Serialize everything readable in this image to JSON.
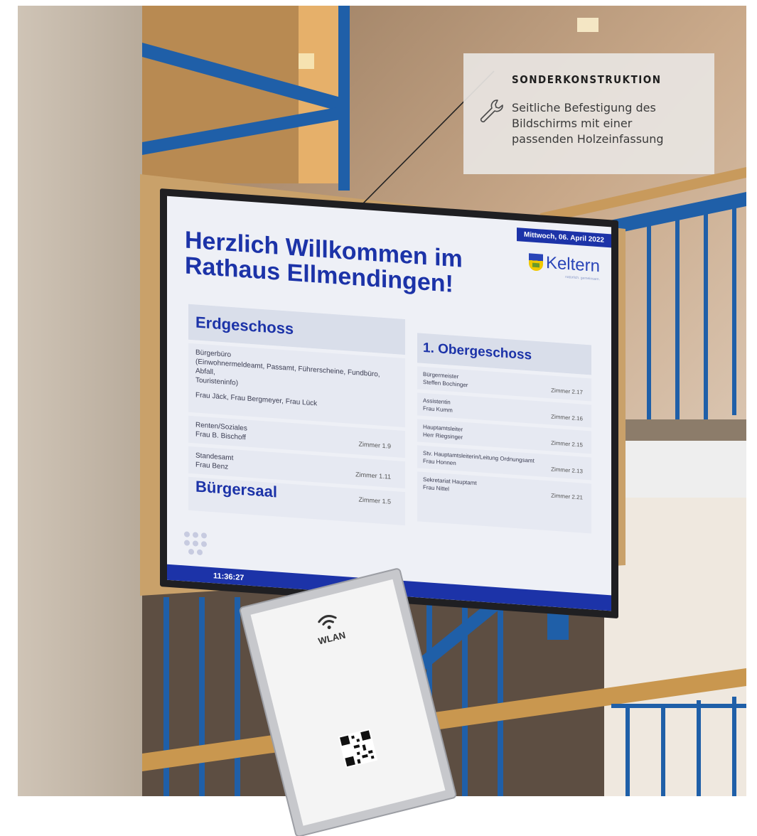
{
  "callout": {
    "title": "SONDERKONSTRUKTION",
    "lines": [
      "Seitliche Befestigung des",
      "Bildschirms mit einer",
      "passenden Holzeinfassung"
    ],
    "icon": "wrench-icon"
  },
  "display": {
    "headline": [
      "Herzlich Willkommen im",
      "Rathaus Ellmendingen!"
    ],
    "date": "Mittwoch, 06. April 2022",
    "logo": {
      "name": "Keltern",
      "tagline": "natürlich. gemeinsam."
    },
    "clock": "11:36:27",
    "erdgeschoss": {
      "title": "Erdgeschoss",
      "buergerbuero": {
        "lines": [
          "Bürgerbüro",
          "(Einwohnermeldeamt, Passamt, Führerscheine, Fundbüro, Abfall,",
          "Touristeninfo)"
        ],
        "staff": "Frau Jäck, Frau Bergmeyer, Frau Lück"
      },
      "entries": [
        {
          "lines": [
            "Renten/Soziales",
            "Frau B. Bischoff"
          ],
          "room": "Zimmer 1.9"
        },
        {
          "lines": [
            "Standesamt",
            "Frau Benz"
          ],
          "room": "Zimmer 1.11"
        }
      ],
      "buergersaal": {
        "name": "Bürgersaal",
        "room": "Zimmer 1.5"
      }
    },
    "obergeschoss": {
      "title": "1. Obergeschoss",
      "entries": [
        {
          "lines": [
            "Bürgermeister",
            "Steffen Bochinger"
          ],
          "room": "Zimmer 2.17"
        },
        {
          "lines": [
            "Assistentin",
            "Frau Kumm"
          ],
          "room": "Zimmer 2.16"
        },
        {
          "lines": [
            "Hauptamtsleiter",
            "Herr Riegsinger"
          ],
          "room": "Zimmer 2.15"
        },
        {
          "lines": [
            "Stv. Hauptamtsleiterin/Leitung Ordnungsamt",
            "Frau Honnen"
          ],
          "room": "Zimmer 2.13"
        },
        {
          "lines": [
            "Sekretariat Hauptamt",
            "Frau Nittel"
          ],
          "room": "Zimmer 2.21"
        }
      ]
    }
  },
  "wlan_sign": {
    "title": "WLAN"
  },
  "colors": {
    "brand_blue": "#1c33a8",
    "wood": "#c9a16a",
    "railing_blue": "#1f5fa8"
  }
}
